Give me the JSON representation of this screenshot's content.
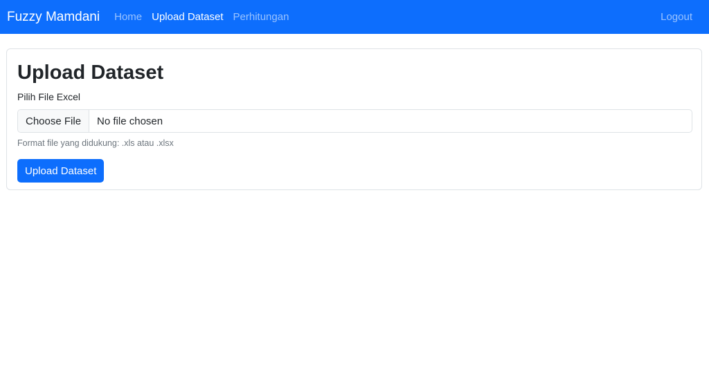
{
  "navbar": {
    "brand": "Fuzzy Mamdani",
    "links": [
      {
        "label": "Home",
        "active": false
      },
      {
        "label": "Upload Dataset",
        "active": true
      },
      {
        "label": "Perhitungan",
        "active": false
      }
    ],
    "logout": "Logout",
    "background": "#0d6efd"
  },
  "main": {
    "title": "Upload Dataset",
    "file_label": "Pilih File Excel",
    "file_button": "Choose File",
    "file_status": "No file chosen",
    "help_text": "Format file yang didukung: .xls atau .xlsx",
    "submit_label": "Upload Dataset",
    "accent": "#0d6efd"
  }
}
